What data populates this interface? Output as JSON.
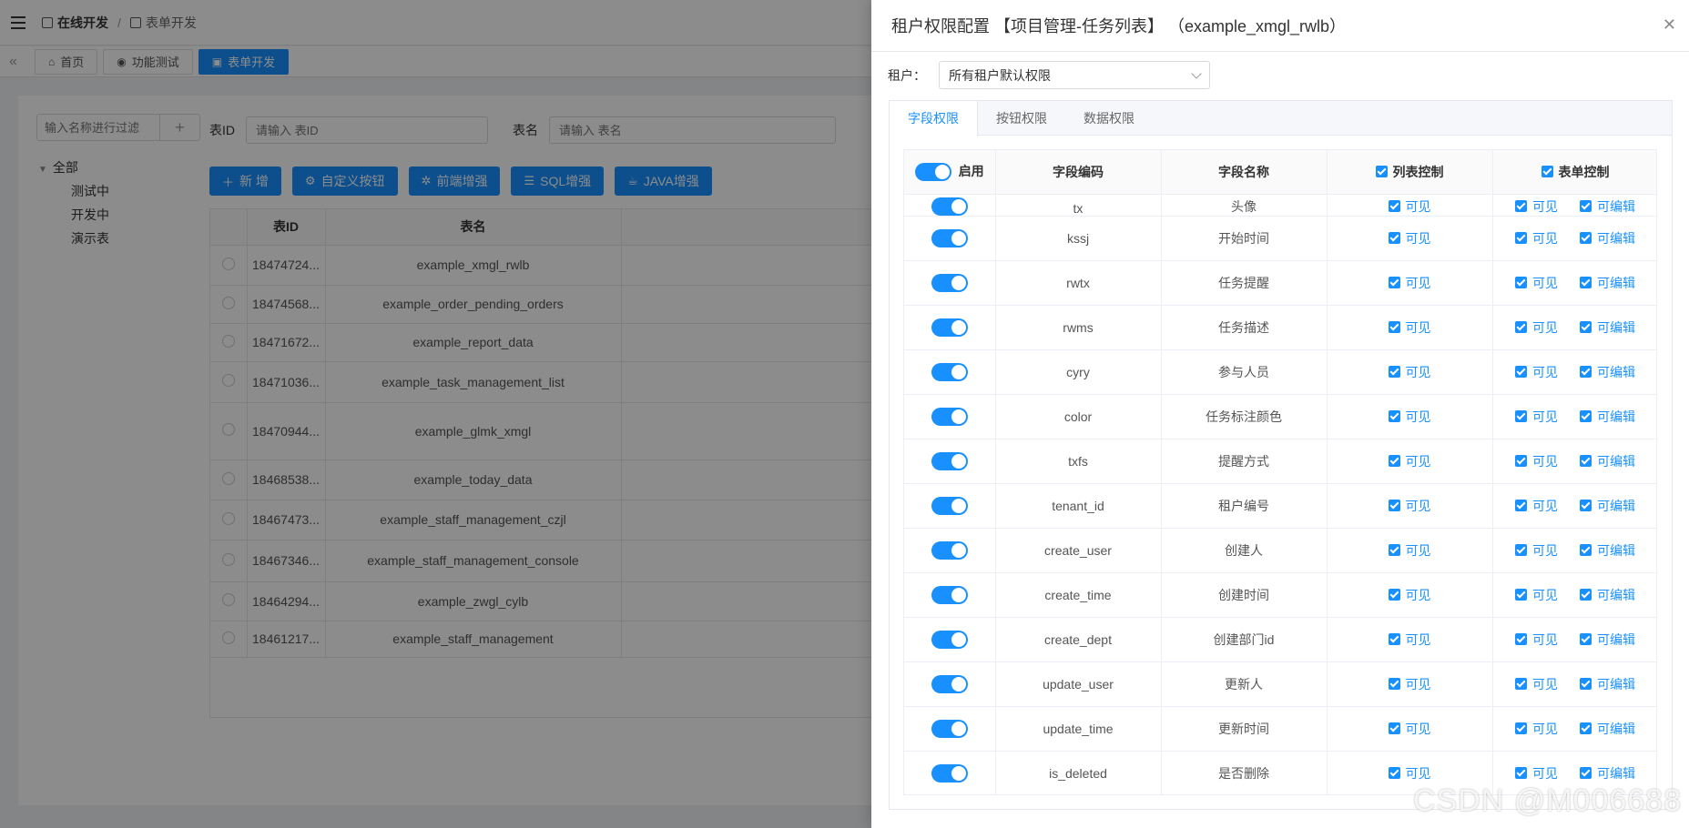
{
  "header": {
    "breadcrumb_root": "在线开发",
    "breadcrumb_current": "表单开发"
  },
  "page_tabs": [
    {
      "label": "首页",
      "icon": "home-icon"
    },
    {
      "label": "功能测试",
      "icon": "eye-icon"
    },
    {
      "label": "表单开发",
      "icon": "form-icon",
      "active": true
    }
  ],
  "sidebar": {
    "search_placeholder": "输入名称进行过滤",
    "tree_root": "全部",
    "tree_children": [
      "测试中",
      "开发中",
      "演示表"
    ]
  },
  "filters": {
    "table_id_label": "表ID",
    "table_id_placeholder": "请输入 表ID",
    "table_name_label": "表名",
    "table_name_placeholder": "请输入 表名"
  },
  "toolbar": {
    "buttons": [
      "新 增",
      "自定义按钮",
      "前端增强",
      "SQL增强",
      "JAVA增强"
    ]
  },
  "bg_table": {
    "columns": [
      "表ID",
      "表名"
    ],
    "rows": [
      {
        "id": "18474724...",
        "name": "example_xmgl_rwlb"
      },
      {
        "id": "18474568...",
        "name": "example_order_pending_orders"
      },
      {
        "id": "18471672...",
        "name": "example_report_data"
      },
      {
        "id": "18471036...",
        "name": "example_task_management_list"
      },
      {
        "id": "18470944...",
        "name": "example_glmk_xmgl"
      },
      {
        "id": "18468538...",
        "name": "example_today_data"
      },
      {
        "id": "18467473...",
        "name": "example_staff_management_czjl"
      },
      {
        "id": "18467346...",
        "name": "example_staff_management_console"
      },
      {
        "id": "18464294...",
        "name": "example_zwgl_cylb"
      },
      {
        "id": "18461217...",
        "name": "example_staff_management"
      }
    ]
  },
  "drawer": {
    "title": "租户权限配置 【项目管理-任务列表】 （example_xmgl_rwlb）",
    "tenant_label": "租户：",
    "tenant_value": "所有租户默认权限",
    "tabs": [
      "字段权限",
      "按钮权限",
      "数据权限"
    ],
    "columns": {
      "enable": "启用",
      "field_code": "字段编码",
      "field_name": "字段名称",
      "list_control": "列表控制",
      "form_control": "表单控制"
    },
    "visible_label": "可见",
    "editable_label": "可编辑",
    "rows": [
      {
        "code": "tx",
        "name": "头像"
      },
      {
        "code": "kssj",
        "name": "开始时间"
      },
      {
        "code": "rwtx",
        "name": "任务提醒"
      },
      {
        "code": "rwms",
        "name": "任务描述"
      },
      {
        "code": "cyry",
        "name": "参与人员"
      },
      {
        "code": "color",
        "name": "任务标注颜色"
      },
      {
        "code": "txfs",
        "name": "提醒方式"
      },
      {
        "code": "tenant_id",
        "name": "租户编号"
      },
      {
        "code": "create_user",
        "name": "创建人"
      },
      {
        "code": "create_time",
        "name": "创建时间"
      },
      {
        "code": "create_dept",
        "name": "创建部门id"
      },
      {
        "code": "update_user",
        "name": "更新人"
      },
      {
        "code": "update_time",
        "name": "更新时间"
      },
      {
        "code": "is_deleted",
        "name": "是否删除"
      }
    ]
  },
  "watermark": "CSDN @M006688"
}
